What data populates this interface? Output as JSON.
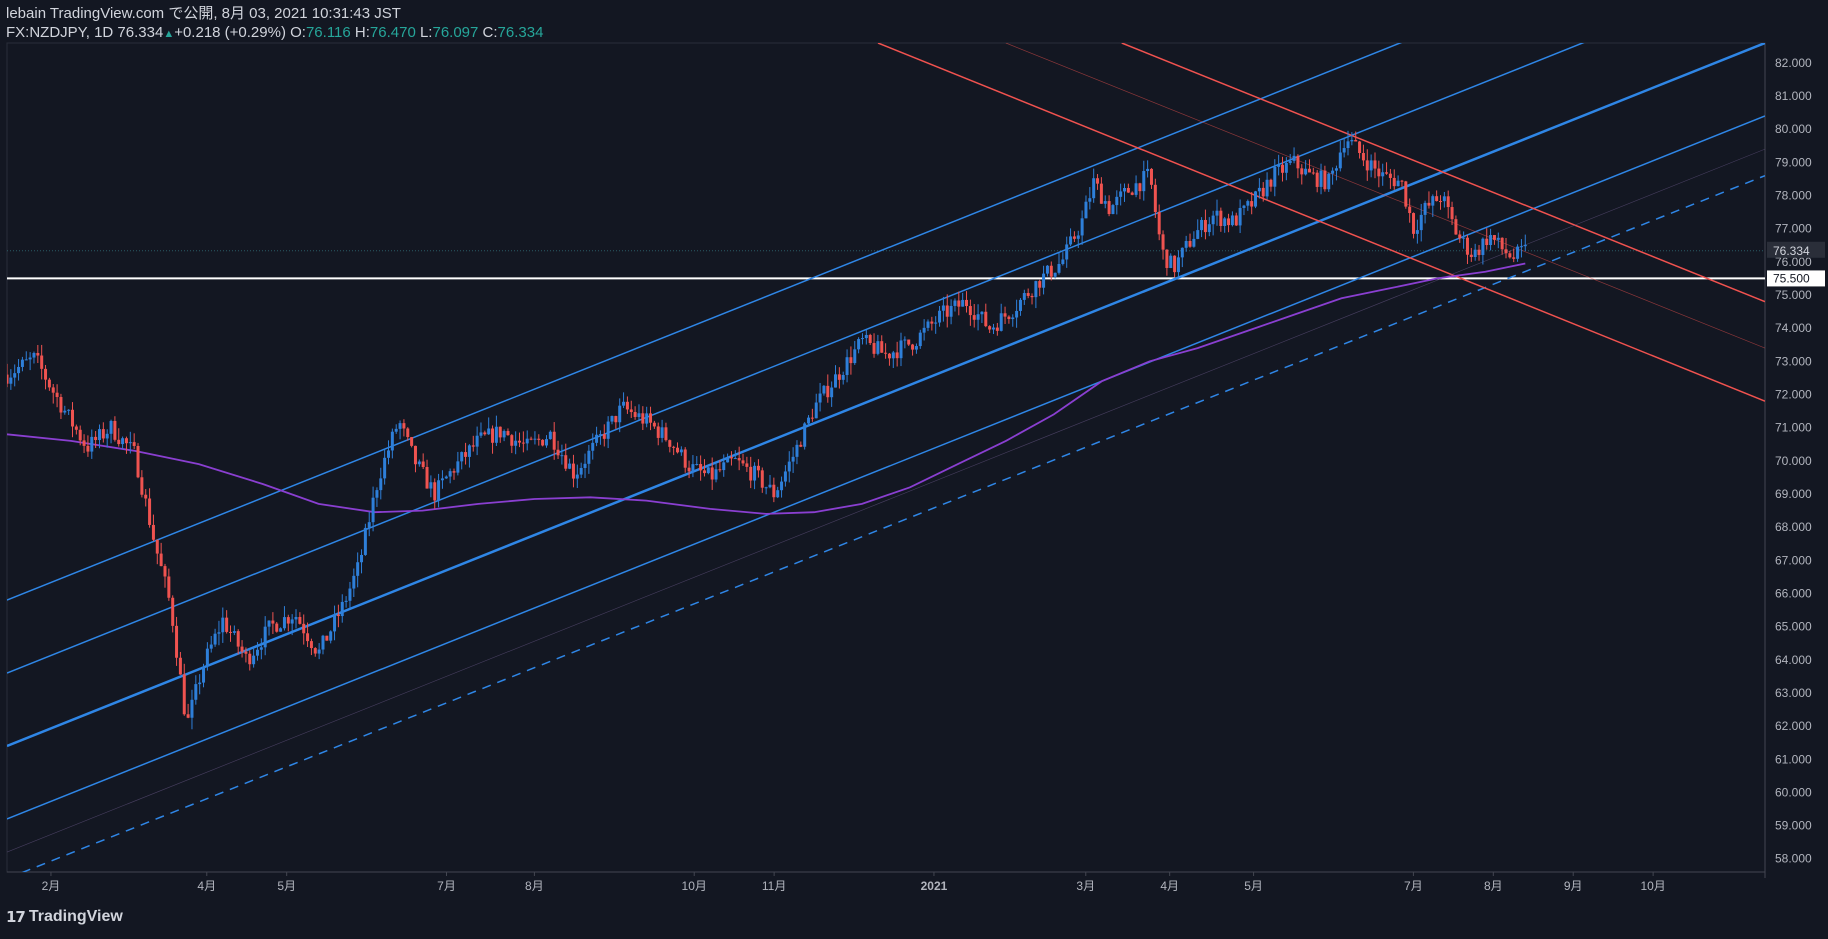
{
  "header": {
    "publisher": "lebain TradingView.com で公開, 8月 03, 2021 10:31:43 JST",
    "symbol": "FX:NZDJPY, 1D",
    "last": "76.334",
    "change": "+0.218 (+0.29%)",
    "o_label": "O:",
    "o_val": "76.116",
    "h_label": "H:",
    "h_val": "76.470",
    "l_label": "L:",
    "l_val": "76.097",
    "c_label": "C:",
    "c_val": "76.334"
  },
  "footer": {
    "brand": "TradingView",
    "logo_icon": "tradingview-logo-icon"
  },
  "colors": {
    "background": "#131722",
    "up": "#2962ff",
    "up_candle": "#2e7fd9",
    "down_candle": "#ef5350",
    "channel": "#2f86e6",
    "descending": "#f0524f",
    "ma": "#8a3fd1",
    "level": "#ffffff"
  },
  "chart_data": {
    "type": "candlestick",
    "symbol": "FX:NZDJPY",
    "interval": "1D",
    "ylim": [
      57.6,
      82.6
    ],
    "y_ticks": [
      "82.000",
      "81.000",
      "80.000",
      "79.000",
      "78.000",
      "77.000",
      "76.000",
      "75.000",
      "74.000",
      "73.000",
      "72.000",
      "71.000",
      "70.000",
      "69.000",
      "68.000",
      "67.000",
      "66.000",
      "65.000",
      "64.000",
      "63.000",
      "62.000",
      "61.000",
      "60.000",
      "59.000",
      "58.000"
    ],
    "x_ticks": [
      {
        "label": "2月",
        "t": 0.55
      },
      {
        "label": "4月",
        "t": 2.5
      },
      {
        "label": "5月",
        "t": 3.5
      },
      {
        "label": "7月",
        "t": 5.5
      },
      {
        "label": "8月",
        "t": 6.6
      },
      {
        "label": "10月",
        "t": 8.6
      },
      {
        "label": "11月",
        "t": 9.6
      },
      {
        "label": "2021",
        "t": 11.6
      },
      {
        "label": "3月",
        "t": 13.5
      },
      {
        "label": "4月",
        "t": 14.55
      },
      {
        "label": "5月",
        "t": 15.6
      },
      {
        "label": "7月",
        "t": 17.6
      },
      {
        "label": "8月",
        "t": 18.6
      },
      {
        "label": "9月",
        "t": 19.6
      },
      {
        "label": "10月",
        "t": 20.6
      }
    ],
    "xlim": [
      0,
      22
    ],
    "key_level": {
      "value": 75.5,
      "label": "75.500"
    },
    "last_price": {
      "value": 76.334,
      "label": "76.334"
    },
    "path_anchors": [
      [
        0.0,
        72.6
      ],
      [
        0.35,
        73.1
      ],
      [
        0.6,
        72.0
      ],
      [
        0.8,
        71.2
      ],
      [
        1.0,
        70.4
      ],
      [
        1.3,
        71.0
      ],
      [
        1.6,
        70.2
      ],
      [
        1.85,
        67.5
      ],
      [
        2.05,
        65.6
      ],
      [
        2.25,
        62.0
      ],
      [
        2.45,
        63.8
      ],
      [
        2.7,
        65.2
      ],
      [
        3.0,
        64.0
      ],
      [
        3.3,
        65.0
      ],
      [
        3.6,
        65.4
      ],
      [
        3.9,
        64.2
      ],
      [
        4.2,
        65.6
      ],
      [
        4.4,
        66.8
      ],
      [
        4.65,
        69.5
      ],
      [
        4.9,
        71.2
      ],
      [
        5.1,
        70.0
      ],
      [
        5.35,
        69.0
      ],
      [
        5.6,
        69.8
      ],
      [
        5.9,
        70.6
      ],
      [
        6.2,
        70.9
      ],
      [
        6.5,
        70.4
      ],
      [
        6.8,
        70.8
      ],
      [
        7.1,
        69.6
      ],
      [
        7.4,
        70.6
      ],
      [
        7.7,
        71.6
      ],
      [
        8.0,
        71.2
      ],
      [
        8.3,
        70.6
      ],
      [
        8.55,
        69.8
      ],
      [
        8.8,
        69.5
      ],
      [
        9.1,
        70.0
      ],
      [
        9.35,
        69.6
      ],
      [
        9.6,
        69.0
      ],
      [
        9.85,
        70.2
      ],
      [
        10.1,
        71.6
      ],
      [
        10.4,
        72.6
      ],
      [
        10.7,
        73.6
      ],
      [
        11.0,
        73.2
      ],
      [
        11.35,
        73.6
      ],
      [
        11.7,
        74.4
      ],
      [
        12.0,
        74.8
      ],
      [
        12.3,
        74.0
      ],
      [
        12.6,
        74.6
      ],
      [
        12.9,
        75.4
      ],
      [
        13.2,
        76.0
      ],
      [
        13.45,
        77.2
      ],
      [
        13.6,
        78.4
      ],
      [
        13.8,
        77.6
      ],
      [
        14.05,
        78.2
      ],
      [
        14.3,
        78.6
      ],
      [
        14.45,
        76.3
      ],
      [
        14.6,
        75.8
      ],
      [
        14.85,
        76.8
      ],
      [
        15.1,
        77.4
      ],
      [
        15.35,
        77.2
      ],
      [
        15.6,
        77.8
      ],
      [
        15.85,
        78.6
      ],
      [
        16.1,
        79.0
      ],
      [
        16.3,
        78.6
      ],
      [
        16.55,
        78.4
      ],
      [
        16.75,
        79.8
      ],
      [
        16.95,
        79.2
      ],
      [
        17.2,
        78.6
      ],
      [
        17.45,
        78.4
      ],
      [
        17.6,
        77.0
      ],
      [
        17.75,
        77.6
      ],
      [
        17.95,
        78.0
      ],
      [
        18.15,
        76.8
      ],
      [
        18.35,
        76.2
      ],
      [
        18.55,
        76.8
      ],
      [
        18.7,
        76.4
      ],
      [
        18.85,
        76.12
      ],
      [
        19.0,
        76.33
      ]
    ],
    "series": [
      {
        "name": "",
        "kind": "moving_average",
        "points": [
          [
            0.0,
            70.8
          ],
          [
            0.8,
            70.6
          ],
          [
            1.6,
            70.3
          ],
          [
            2.4,
            69.9
          ],
          [
            3.2,
            69.3
          ],
          [
            3.9,
            68.7
          ],
          [
            4.6,
            68.45
          ],
          [
            5.2,
            68.5
          ],
          [
            5.9,
            68.7
          ],
          [
            6.6,
            68.85
          ],
          [
            7.3,
            68.9
          ],
          [
            8.0,
            68.8
          ],
          [
            8.8,
            68.55
          ],
          [
            9.5,
            68.4
          ],
          [
            10.1,
            68.45
          ],
          [
            10.7,
            68.7
          ],
          [
            11.3,
            69.2
          ],
          [
            11.9,
            69.9
          ],
          [
            12.5,
            70.6
          ],
          [
            13.1,
            71.4
          ],
          [
            13.7,
            72.4
          ],
          [
            14.3,
            73.0
          ],
          [
            14.9,
            73.4
          ],
          [
            15.5,
            73.9
          ],
          [
            16.1,
            74.4
          ],
          [
            16.7,
            74.9
          ],
          [
            17.3,
            75.2
          ],
          [
            17.9,
            75.5
          ],
          [
            18.5,
            75.7
          ],
          [
            19.0,
            75.95
          ]
        ]
      }
    ],
    "trendlines": [
      {
        "name": "",
        "style": "solid",
        "width": 2.5,
        "color_key": "channel",
        "p1": [
          0,
          61.4
        ],
        "p2": [
          22,
          82.6
        ]
      },
      {
        "name": "",
        "style": "solid",
        "width": 1.5,
        "color_key": "channel",
        "p1": [
          0,
          63.6
        ],
        "p2": [
          22,
          84.8
        ]
      },
      {
        "name": "",
        "style": "solid",
        "width": 1.5,
        "color_key": "channel",
        "p1": [
          0,
          65.8
        ],
        "p2": [
          22,
          87.0
        ]
      },
      {
        "name": "",
        "style": "solid",
        "width": 1.5,
        "color_key": "channel",
        "p1": [
          0,
          59.2
        ],
        "p2": [
          22,
          80.4
        ]
      },
      {
        "name": "",
        "style": "dashed",
        "width": 1.5,
        "color_key": "channel",
        "p1": [
          0,
          57.4
        ],
        "p2": [
          22,
          78.6
        ]
      },
      {
        "name": "",
        "style": "thin",
        "width": 0.7,
        "color_key": "descending",
        "p1": [
          12.5,
          82.6
        ],
        "p2": [
          22,
          73.4
        ]
      },
      {
        "name": "",
        "style": "solid",
        "width": 1.5,
        "color_key": "descending",
        "p1": [
          10.9,
          82.6
        ],
        "p2": [
          22,
          71.8
        ]
      },
      {
        "name": "",
        "style": "solid",
        "width": 1.5,
        "color_key": "descending",
        "p1": [
          13.95,
          82.6
        ],
        "p2": [
          22,
          74.8
        ]
      }
    ]
  }
}
